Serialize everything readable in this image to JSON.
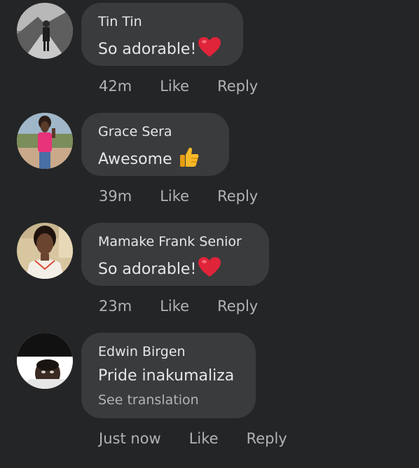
{
  "colors": {
    "background": "#242526",
    "bubble": "#3a3b3c",
    "primary_text": "#e4e6eb",
    "secondary_text": "#b0b3b8",
    "heart": "#e0243a",
    "thumb": "#f7b928"
  },
  "comments": [
    {
      "author": "Tin Tin",
      "text": "So adorable!",
      "emoji": "heart-icon",
      "time": "42m",
      "like_label": "Like",
      "reply_label": "Reply"
    },
    {
      "author": "Grace Sera",
      "text": "Awesome",
      "emoji": "thumbs-up-icon",
      "time": "39m",
      "like_label": "Like",
      "reply_label": "Reply"
    },
    {
      "author": "Mamake Frank Senior",
      "text": "So adorable!",
      "emoji": "heart-icon",
      "time": "23m",
      "like_label": "Like",
      "reply_label": "Reply"
    },
    {
      "author": "Edwin Birgen",
      "text": "Pride inakumaliza",
      "see_translation": "See translation",
      "time": "Just now",
      "like_label": "Like",
      "reply_label": "Reply"
    }
  ]
}
